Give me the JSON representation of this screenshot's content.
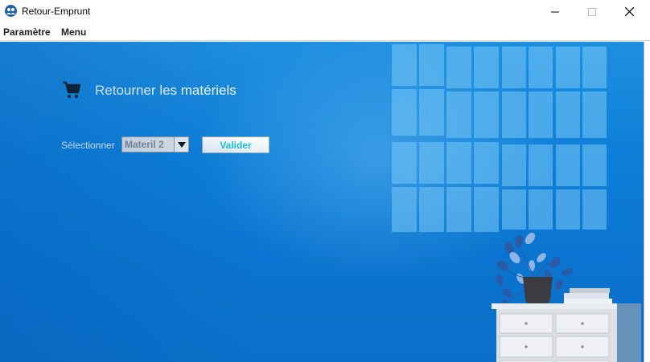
{
  "window": {
    "title": "Retour-Emprunt",
    "controls": {
      "minimize": "minimize-icon",
      "maximize": "maximize-icon",
      "close": "close-icon"
    }
  },
  "menubar": {
    "items": [
      {
        "label": "Paramètre"
      },
      {
        "label": "Menu"
      }
    ]
  },
  "form": {
    "title": "Retourner les matériels",
    "title_icon": "cart-icon",
    "select_label": "Sélectionner",
    "select_value": "Materil 2",
    "submit_label": "Valider"
  },
  "colors": {
    "background": "#0d7fd8",
    "submit_text": "#1ec4d6",
    "title_text": "#ffffff"
  }
}
